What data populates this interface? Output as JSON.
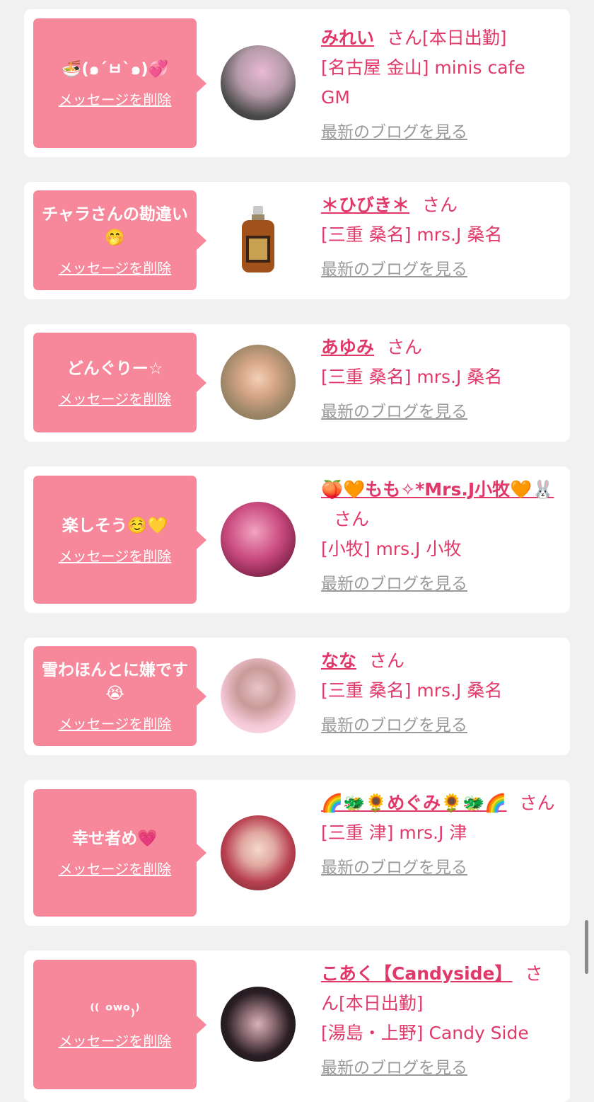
{
  "delete_label": "メッセージを削除",
  "san_label": "さん",
  "blog_label": "最新のブログを見る",
  "colors": {
    "bubble": "#f7889b",
    "accent_pink": "#e1386a",
    "link_gray": "#9a9a9a",
    "background": "#f1f1f1"
  },
  "entries": [
    {
      "message": "🍜(๑´ㅂ`๑)💞",
      "name": "みれい",
      "status": "[本日出勤]",
      "shop": "[名古屋 金山] minis cafe GM",
      "avatar": "girl-photo-avatar"
    },
    {
      "message": "チャラさんの勘違い🤭",
      "name": "＊ひびき＊",
      "status": "",
      "shop": "[三重 桑名] mrs.J 桑名",
      "avatar": "whisky-bottle-avatar"
    },
    {
      "message": "どんぐりー☆",
      "name": "あゆみ",
      "status": "",
      "shop": "[三重 桑名] mrs.J 桑名",
      "avatar": "girl-photo-avatar"
    },
    {
      "message": "楽しそう☺️💛",
      "name": "🍑🧡もも✧*Mrs.J小牧🧡🐰",
      "status": "",
      "shop": "[小牧] mrs.J 小牧",
      "avatar": "girl-photo-avatar"
    },
    {
      "message": "雪わほんとに嫌です😭",
      "name": "なな",
      "status": "",
      "shop": "[三重 桑名] mrs.J 桑名",
      "avatar": "girl-photo-avatar"
    },
    {
      "message": "幸せ者め💗",
      "name": "🌈🐲🌻めぐみ🌻🐲🌈",
      "status": "",
      "shop": "[三重 津] mrs.J 津",
      "avatar": "girl-photo-avatar"
    },
    {
      "message": "⁽⁽ ᵒʷᵒ₎⁾",
      "name": "こあく【Candyside】",
      "status": "[本日出勤]",
      "shop": "[湯島・上野] Candy Side",
      "avatar": "girl-photo-avatar"
    }
  ]
}
